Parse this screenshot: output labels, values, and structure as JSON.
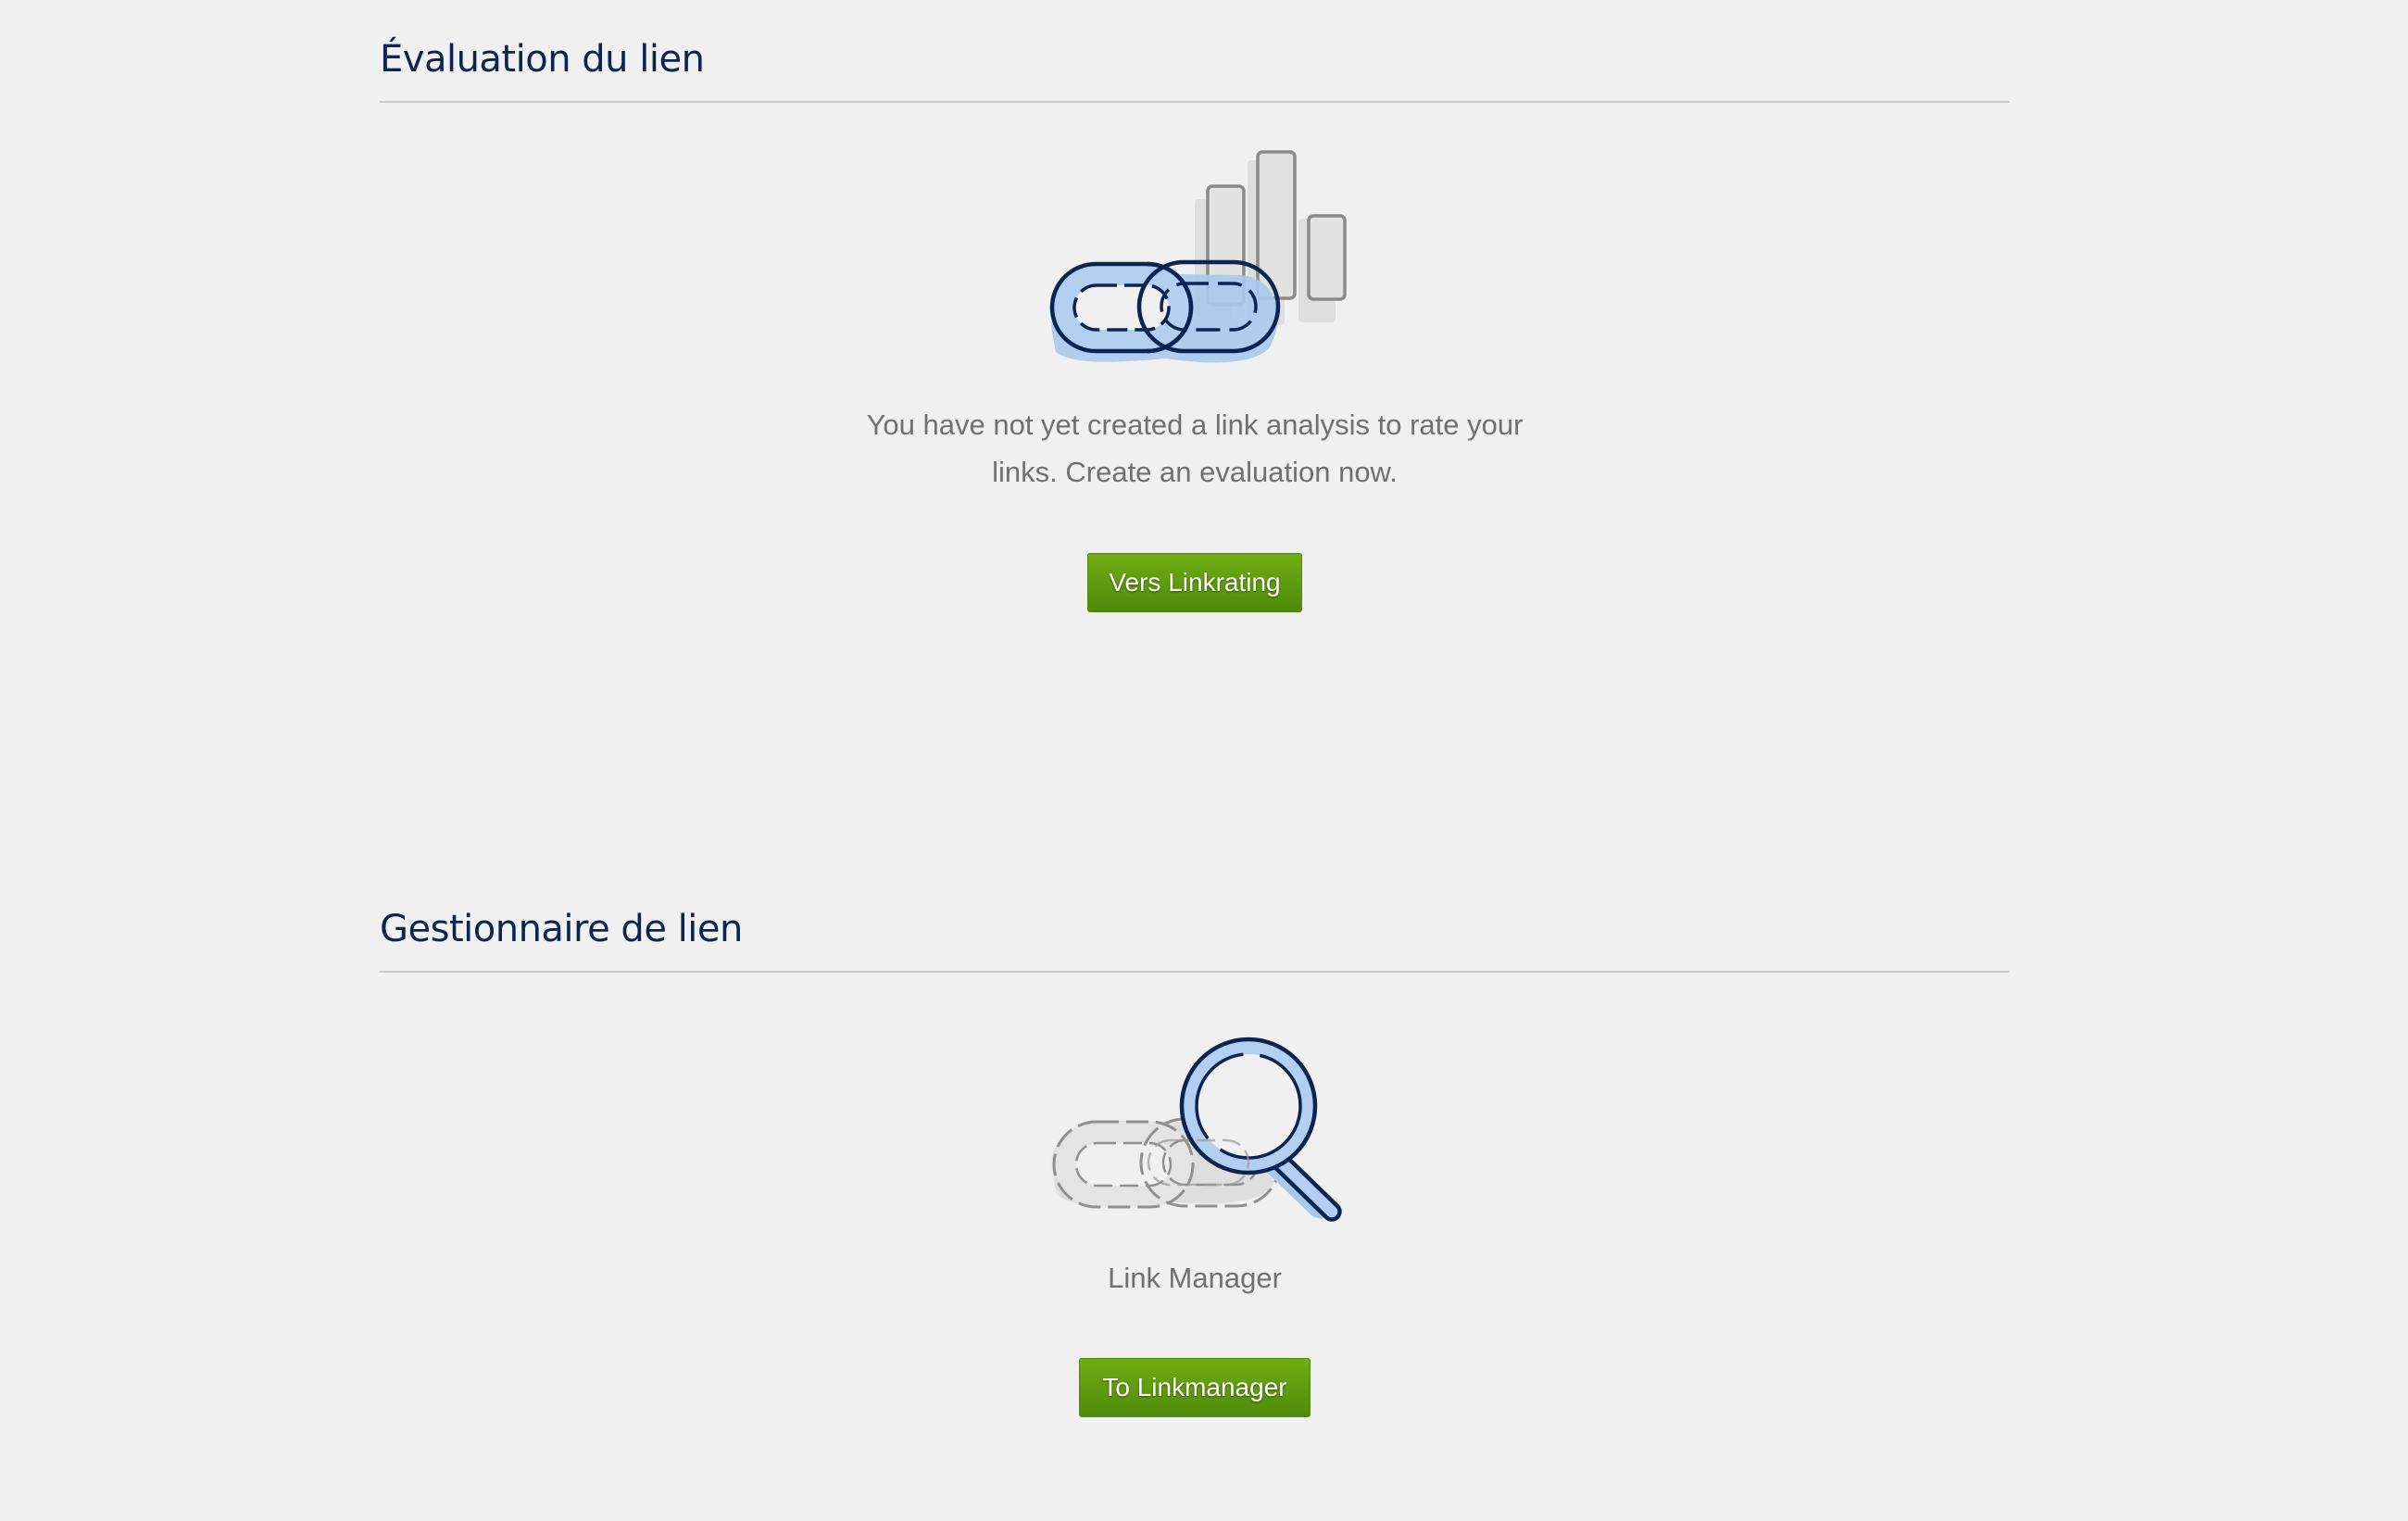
{
  "link_rating": {
    "title": "Évaluation du lien",
    "message_line1": "You have not yet created a link analysis to rate your",
    "message_line2": "links. Create an evaluation now.",
    "button_label": "Vers Linkrating",
    "illustration_icon": "link-chain-bar-chart-icon"
  },
  "link_manager": {
    "title": "Gestionnaire de lien",
    "message": "Link Manager",
    "button_label": "To Linkmanager",
    "illustration_icon": "link-chain-magnifier-icon"
  },
  "colors": {
    "background": "#f0f0f0",
    "heading": "#0b2550",
    "body_text": "#707070",
    "button_green": "#5c9a0f",
    "illustration_blue": "#a9c9ec",
    "illustration_navy": "#0b2550"
  }
}
